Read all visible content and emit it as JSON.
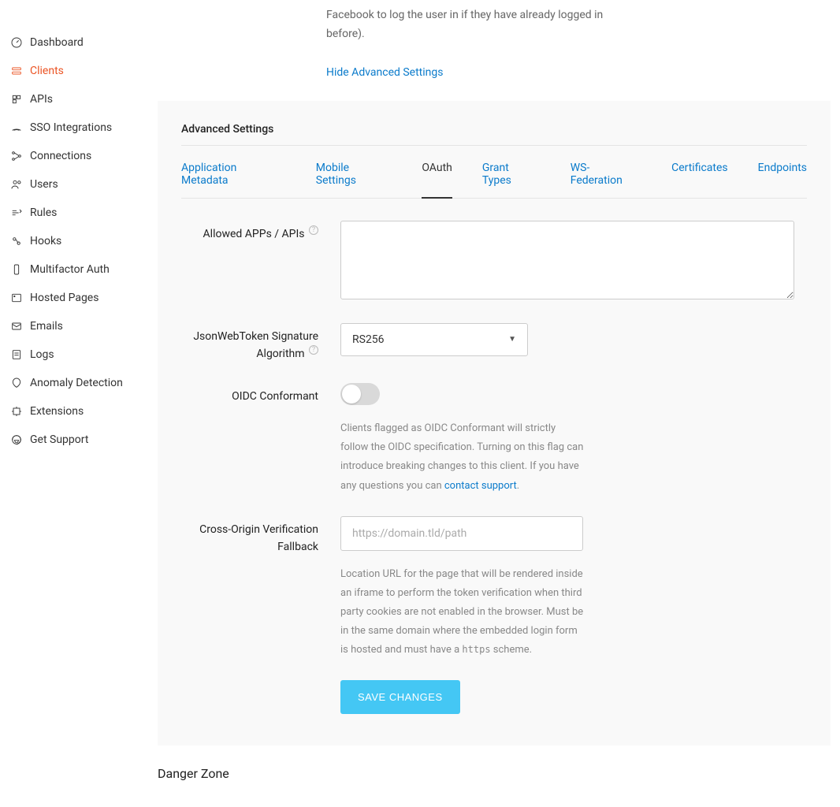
{
  "sidebar": {
    "items": [
      {
        "label": "Dashboard",
        "name": "dashboard"
      },
      {
        "label": "Clients",
        "name": "clients"
      },
      {
        "label": "APIs",
        "name": "apis"
      },
      {
        "label": "SSO Integrations",
        "name": "sso-integrations"
      },
      {
        "label": "Connections",
        "name": "connections"
      },
      {
        "label": "Users",
        "name": "users"
      },
      {
        "label": "Rules",
        "name": "rules"
      },
      {
        "label": "Hooks",
        "name": "hooks"
      },
      {
        "label": "Multifactor Auth",
        "name": "multifactor-auth"
      },
      {
        "label": "Hosted Pages",
        "name": "hosted-pages"
      },
      {
        "label": "Emails",
        "name": "emails"
      },
      {
        "label": "Logs",
        "name": "logs"
      },
      {
        "label": "Anomaly Detection",
        "name": "anomaly-detection"
      },
      {
        "label": "Extensions",
        "name": "extensions"
      },
      {
        "label": "Get Support",
        "name": "get-support"
      }
    ]
  },
  "top_paragraph_part": "Facebook to log the user in if they have already logged in before).",
  "hide_advanced": "Hide Advanced Settings",
  "advanced_title": "Advanced Settings",
  "tabs": [
    {
      "label": "Application Metadata"
    },
    {
      "label": "Mobile Settings"
    },
    {
      "label": "OAuth"
    },
    {
      "label": "Grant Types"
    },
    {
      "label": "WS-Federation"
    },
    {
      "label": "Certificates"
    },
    {
      "label": "Endpoints"
    }
  ],
  "fields": {
    "allowed_apps_label": "Allowed APPs / APIs",
    "jwt_label": "JsonWebToken Signature Algorithm",
    "jwt_value": "RS256",
    "oidc_label": "OIDC Conformant",
    "oidc_desc_before": "Clients flagged as OIDC Conformant will strictly follow the OIDC specification. Turning on this flag can introduce breaking changes to this client. If you have any questions you can ",
    "oidc_desc_link": "contact support",
    "oidc_desc_after": ".",
    "cors_label": "Cross-Origin Verification Fallback",
    "cors_placeholder": "https://domain.tld/path",
    "cors_desc_before": "Location URL for the page that will be rendered inside an iframe to perform the token verification when third party cookies are not enabled in the browser. Must be in the same domain where the embedded login form is hosted and must have a ",
    "cors_code": "https",
    "cors_desc_after": " scheme."
  },
  "save_label": "SAVE CHANGES",
  "danger_zone": "Danger Zone"
}
